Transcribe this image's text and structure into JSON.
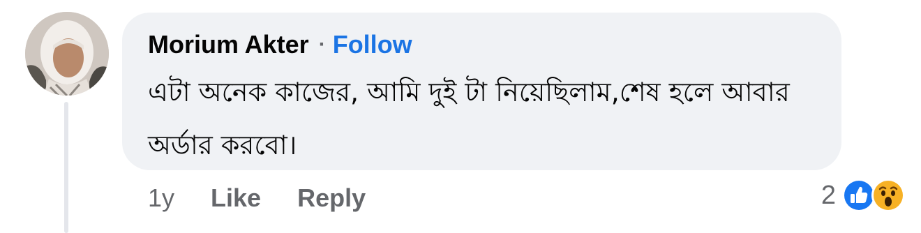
{
  "comment": {
    "author": "Morium Akter",
    "separator": "·",
    "follow_label": "Follow",
    "text": "এটা অনেক কাজের, আমি দুই টা নিয়েছিলাম,শেষ  হলে আবার অর্ডার করবো।"
  },
  "actions": {
    "timestamp": "1y",
    "like_label": "Like",
    "reply_label": "Reply"
  },
  "reactions": {
    "count": "2",
    "icons": [
      "like-icon",
      "wow-icon"
    ]
  },
  "colors": {
    "bubble": "#f0f2f5",
    "follow": "#1b74e4",
    "secondary_text": "#65676b",
    "like_blue": "#1877f2",
    "wow_yellow": "#f7b125"
  }
}
